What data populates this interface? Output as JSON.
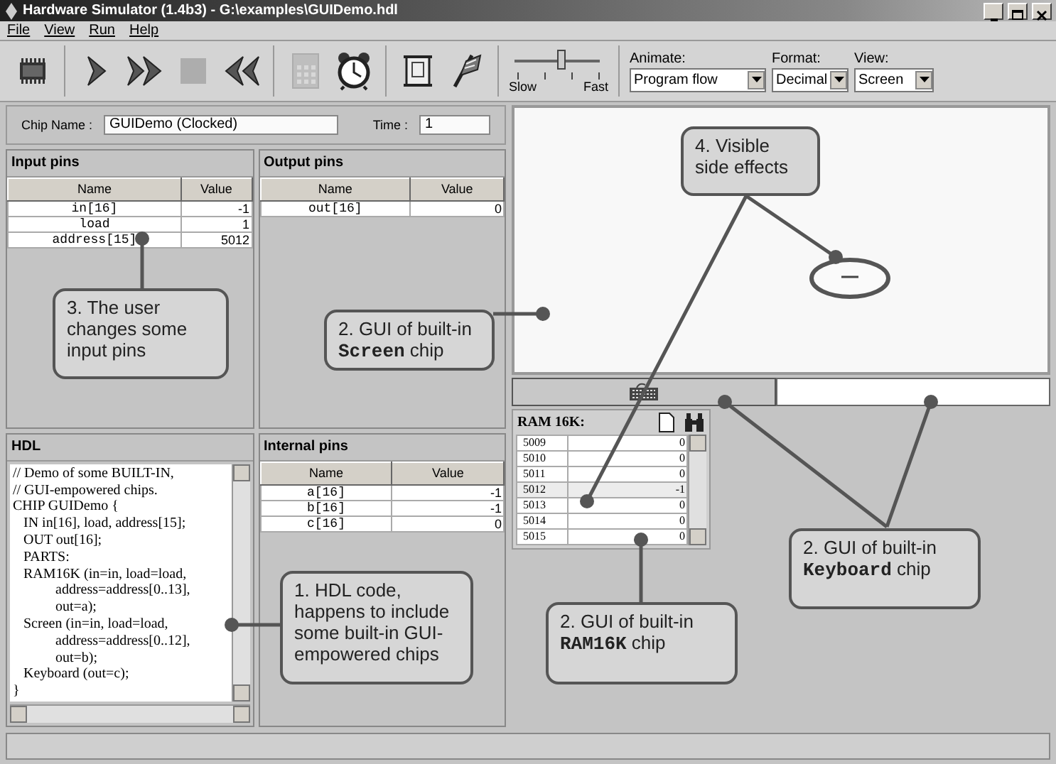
{
  "window": {
    "title": "Hardware Simulator (1.4b3) - G:\\examples\\GUIDemo.hdl"
  },
  "menu": [
    "File",
    "View",
    "Run",
    "Help"
  ],
  "toolbar": {
    "tools": [
      {
        "kind": "chip",
        "disabled": false
      },
      {
        "kind": "step",
        "disabled": false
      },
      {
        "kind": "run",
        "disabled": false
      },
      {
        "kind": "stop",
        "disabled": true
      },
      {
        "kind": "reset",
        "disabled": false
      },
      {
        "kind": "calculator",
        "disabled": true
      },
      {
        "kind": "clock",
        "disabled": false
      },
      {
        "kind": "script",
        "disabled": false
      },
      {
        "kind": "breakpoint",
        "disabled": false
      }
    ],
    "speed": {
      "level": 0.55,
      "min_label": "Slow",
      "max_label": "Fast"
    },
    "selects": [
      {
        "label": "Animate:",
        "value": "Program flow"
      },
      {
        "label": "Format:",
        "value": "Decimal"
      },
      {
        "label": "View:",
        "value": "Screen"
      }
    ]
  },
  "chip_name": {
    "label": "Chip Name :",
    "value": "GUIDemo (Clocked)"
  },
  "time": {
    "label": "Time :",
    "value": "1"
  },
  "input_pins": {
    "title": "Input pins",
    "columns": [
      "Name",
      "Value"
    ],
    "rows": [
      [
        "in[16]",
        "-1"
      ],
      [
        "load",
        "1"
      ],
      [
        "address[15]",
        "5012"
      ]
    ]
  },
  "output_pins": {
    "title": "Output pins",
    "columns": [
      "Name",
      "Value"
    ],
    "rows": [
      [
        "out[16]",
        "0"
      ]
    ]
  },
  "hdl": {
    "title": "HDL",
    "lines": [
      "// Demo of some BUILT-IN,",
      "// GUI-empowered chips.",
      "CHIP GUIDemo {",
      "   IN in[16], load, address[15];",
      "   OUT out[16];",
      "   PARTS:",
      "   RAM16K (in=in, load=load,",
      "            address=address[0..13],",
      "            out=a);",
      "   Screen (in=in, load=load,",
      "            address=address[0..12],",
      "            out=b);",
      "   Keyboard (out=c);",
      "}"
    ]
  },
  "internal_pins": {
    "title": "Internal pins",
    "columns": [
      "Name",
      "Value"
    ],
    "rows": [
      [
        "a[16]",
        "-1"
      ],
      [
        "b[16]",
        "-1"
      ],
      [
        "c[16]",
        "0"
      ]
    ]
  },
  "ram": {
    "title": "RAM 16K:",
    "rows": [
      {
        "address": "5009",
        "value": "0",
        "selected": false
      },
      {
        "address": "5010",
        "value": "0",
        "selected": false
      },
      {
        "address": "5011",
        "value": "0",
        "selected": false
      },
      {
        "address": "5012",
        "value": "-1",
        "selected": true
      },
      {
        "address": "5013",
        "value": "0",
        "selected": false
      },
      {
        "address": "5014",
        "value": "0",
        "selected": false
      },
      {
        "address": "5015",
        "value": "0",
        "selected": false
      }
    ]
  },
  "callouts": [
    {
      "text": "4. Visible side effects"
    },
    {
      "text": "3. The user changes some input pins"
    },
    {
      "text": "2. GUI of built-in **Screen** chip"
    },
    {
      "text": "2. GUI of built-in **Keyboard** chip"
    },
    {
      "text": "1. HDL code, happens to include some built-in GUI-empowered chips"
    },
    {
      "text": "2. GUI of built-in **RAM16K** chip"
    }
  ]
}
